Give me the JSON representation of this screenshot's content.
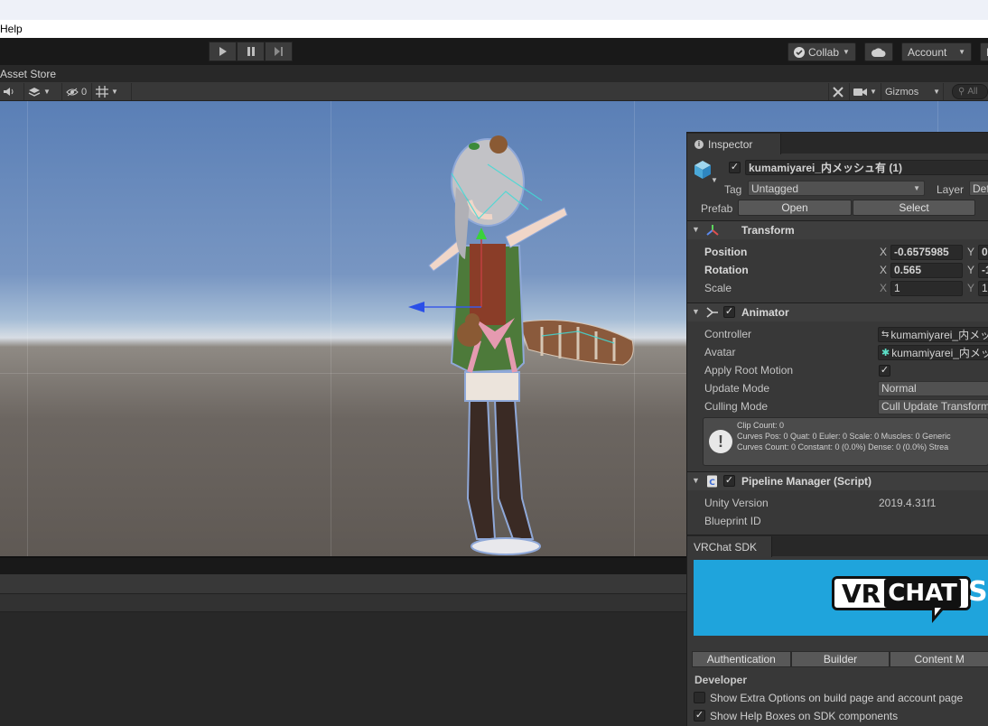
{
  "menu": {
    "visible_item": "Help"
  },
  "toolbar": {
    "play_icon": "play-icon",
    "pause_icon": "pause-icon",
    "step_icon": "step-icon",
    "collab_label": "Collab",
    "account_label": "Account",
    "layers_label": "L"
  },
  "scene_tabs": {
    "visible_tab": "Asset Store"
  },
  "scene_toolbar": {
    "hidden_count": "0",
    "gizmos_label": "Gizmos",
    "search_placeholder": "All"
  },
  "inspector": {
    "tab_label": "Inspector",
    "object_name": "kumamiyarei_内メッシュ有 (1)",
    "tag_label": "Tag",
    "tag_value": "Untagged",
    "layer_label": "Layer",
    "layer_value": "Def",
    "prefab_label": "Prefab",
    "open_label": "Open",
    "select_label": "Select",
    "transform": {
      "title": "Transform",
      "position_label": "Position",
      "rotation_label": "Rotation",
      "scale_label": "Scale",
      "x_axis": "X",
      "y_axis": "Y",
      "position_x": "-0.6575985",
      "position_y": "0.",
      "rotation_x": "0.565",
      "rotation_y": "-1",
      "scale_x": "1",
      "scale_y": "1"
    },
    "animator": {
      "title": "Animator",
      "controller_label": "Controller",
      "controller_value": "kumamiyarei_内メッシ",
      "avatar_label": "Avatar",
      "avatar_value": "kumamiyarei_内メッシ",
      "apply_root_motion_label": "Apply Root Motion",
      "update_mode_label": "Update Mode",
      "update_mode_value": "Normal",
      "culling_mode_label": "Culling Mode",
      "culling_mode_value": "Cull Update Transform",
      "info_line1": "Clip Count: 0",
      "info_line2": "Curves Pos: 0 Quat: 0 Euler: 0 Scale: 0 Muscles: 0 Generic",
      "info_line3": "Curves Count: 0 Constant: 0 (0.0%) Dense: 0 (0.0%) Strea"
    },
    "pipeline": {
      "title": "Pipeline Manager (Script)",
      "unity_version_label": "Unity Version",
      "unity_version_value": "2019.4.31f1",
      "blueprint_id_label": "Blueprint ID"
    }
  },
  "sdk": {
    "tab_label": "VRChat SDK",
    "logo_vr": "VR",
    "logo_chat": "CHAT",
    "logo_side": "SI",
    "tabs": [
      "Authentication",
      "Builder",
      "Content M"
    ],
    "developer_label": "Developer",
    "option1_label": "Show Extra Options on build page and account page",
    "option2_label": "Show Help Boxes on SDK components"
  }
}
